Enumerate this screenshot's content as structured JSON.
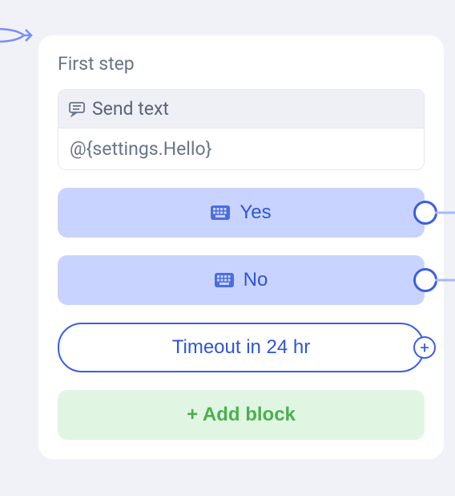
{
  "card": {
    "title": "First step"
  },
  "send": {
    "header_label": "Send text",
    "value": "@{settings.Hello}"
  },
  "options": [
    {
      "label": "Yes"
    },
    {
      "label": "No"
    }
  ],
  "timeout": {
    "label": "Timeout in 24 hr"
  },
  "add_block": {
    "label": "+ Add block"
  }
}
